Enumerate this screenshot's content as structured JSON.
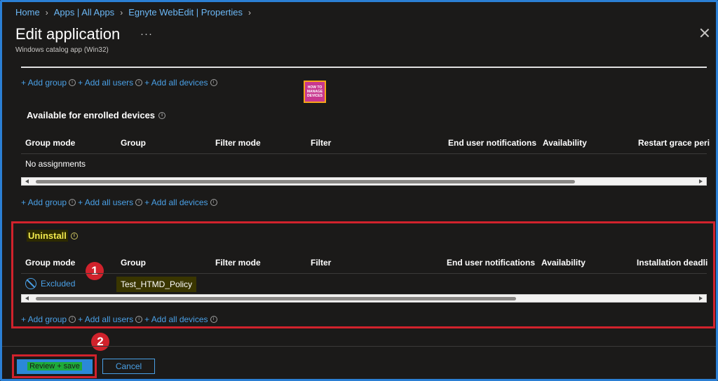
{
  "breadcrumb": [
    "Home",
    "Apps | All Apps",
    "Egnyte WebEdit | Properties"
  ],
  "header": {
    "title": "Edit application",
    "more": "···",
    "subtitle": "Windows catalog app (Win32)"
  },
  "add_links": {
    "add_group": "+ Add group",
    "add_all_users": "+ Add all users",
    "add_all_devices": "+ Add all devices"
  },
  "logo": {
    "line1": "HOW TO",
    "line2": "MANAGE",
    "line3": "DEVICES"
  },
  "available": {
    "title": "Available for enrolled devices",
    "columns": [
      "Group mode",
      "Group",
      "Filter mode",
      "Filter",
      "End user notifications",
      "Availability",
      "Restart grace peri"
    ],
    "empty_text": "No assignments",
    "scroll_fraction": 0.82
  },
  "uninstall": {
    "title": "Uninstall",
    "columns": [
      "Group mode",
      "Group",
      "Filter mode",
      "Filter",
      "End user notifications",
      "Availability",
      "Installation deadli"
    ],
    "rows": [
      {
        "group_mode": "Excluded",
        "group": "Test_HTMD_Policy"
      }
    ],
    "scroll_fraction": 0.73
  },
  "annotations": {
    "badge1": "1",
    "badge2": "2"
  },
  "footer": {
    "review_save": "Review + save",
    "cancel": "Cancel"
  },
  "colors": {
    "accent": "#2b7fd4",
    "link": "#4aa0e6",
    "highlight_red": "#d1222c",
    "background": "#1b1a19"
  }
}
